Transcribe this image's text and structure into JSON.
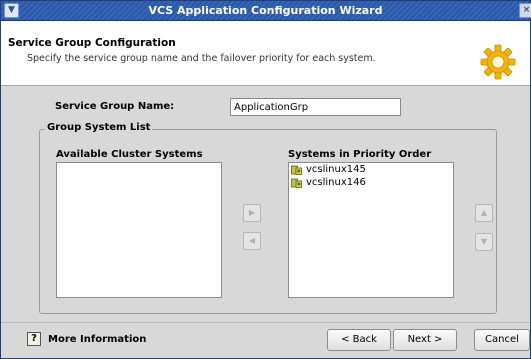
{
  "window": {
    "title": "VCS Application Configuration Wizard"
  },
  "header": {
    "title": "Service Group Configuration",
    "description": "Specify the service group name and the failover priority for each system.",
    "icon": "gear-icon"
  },
  "form": {
    "service_group_label": "Service Group Name:",
    "service_group_value": "ApplicationGrp",
    "group_box_title": "Group System List",
    "available_label": "Available Cluster Systems",
    "available_systems": [],
    "priority_label": "Systems in Priority Order",
    "priority_systems": [
      "vcslinux145",
      "vcslinux146"
    ]
  },
  "footer": {
    "help_glyph": "?",
    "more_info": "More Information",
    "back": "< Back",
    "next": "Next >",
    "cancel": "Cancel"
  },
  "colors": {
    "titlebar": "#2d5aa8",
    "header_bg": "#ffffff",
    "dialog_bg": "#d8d8d8"
  }
}
